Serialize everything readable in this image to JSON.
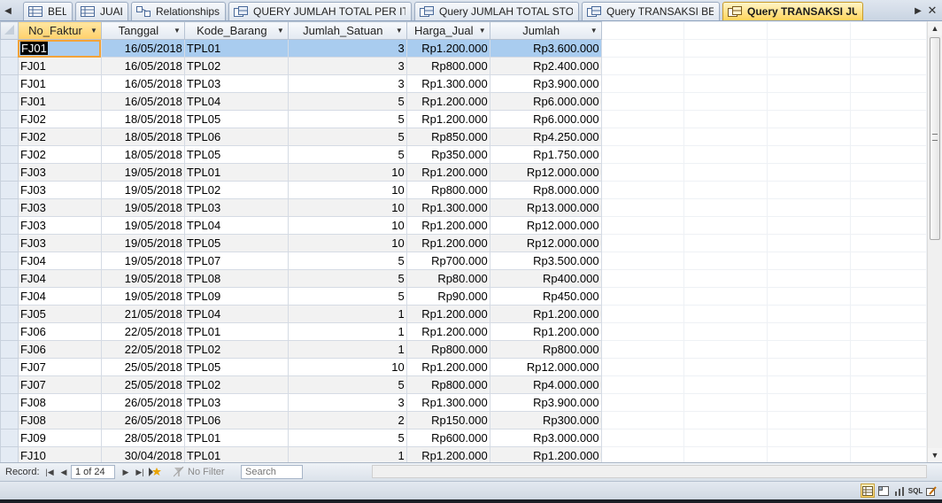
{
  "tabs": [
    {
      "label": "BELI",
      "icon": "table-icon",
      "active": false
    },
    {
      "label": "JUAL",
      "icon": "table-icon",
      "active": false
    },
    {
      "label": "Relationships",
      "icon": "relationships-icon",
      "active": false
    },
    {
      "label": "QUERY JUMLAH TOTAL PER ITEM",
      "icon": "query-icon",
      "active": false
    },
    {
      "label": "Query JUMLAH TOTAL STOCK",
      "icon": "query-icon",
      "active": false
    },
    {
      "label": "Query TRANSAKSI BELI",
      "icon": "query-icon",
      "active": false
    },
    {
      "label": "Query TRANSAKSI JUAL",
      "icon": "query-icon",
      "active": true
    }
  ],
  "columns": [
    "No_Faktur",
    "Tanggal",
    "Kode_Barang",
    "Jumlah_Satuan",
    "Harga_Jual",
    "Jumlah"
  ],
  "rows": [
    [
      "FJ01",
      "16/05/2018",
      "TPL01",
      "3",
      "Rp1.200.000",
      "Rp3.600.000"
    ],
    [
      "FJ01",
      "16/05/2018",
      "TPL02",
      "3",
      "Rp800.000",
      "Rp2.400.000"
    ],
    [
      "FJ01",
      "16/05/2018",
      "TPL03",
      "3",
      "Rp1.300.000",
      "Rp3.900.000"
    ],
    [
      "FJ01",
      "16/05/2018",
      "TPL04",
      "5",
      "Rp1.200.000",
      "Rp6.000.000"
    ],
    [
      "FJ02",
      "18/05/2018",
      "TPL05",
      "5",
      "Rp1.200.000",
      "Rp6.000.000"
    ],
    [
      "FJ02",
      "18/05/2018",
      "TPL06",
      "5",
      "Rp850.000",
      "Rp4.250.000"
    ],
    [
      "FJ02",
      "18/05/2018",
      "TPL05",
      "5",
      "Rp350.000",
      "Rp1.750.000"
    ],
    [
      "FJ03",
      "19/05/2018",
      "TPL01",
      "10",
      "Rp1.200.000",
      "Rp12.000.000"
    ],
    [
      "FJ03",
      "19/05/2018",
      "TPL02",
      "10",
      "Rp800.000",
      "Rp8.000.000"
    ],
    [
      "FJ03",
      "19/05/2018",
      "TPL03",
      "10",
      "Rp1.300.000",
      "Rp13.000.000"
    ],
    [
      "FJ03",
      "19/05/2018",
      "TPL04",
      "10",
      "Rp1.200.000",
      "Rp12.000.000"
    ],
    [
      "FJ03",
      "19/05/2018",
      "TPL05",
      "10",
      "Rp1.200.000",
      "Rp12.000.000"
    ],
    [
      "FJ04",
      "19/05/2018",
      "TPL07",
      "5",
      "Rp700.000",
      "Rp3.500.000"
    ],
    [
      "FJ04",
      "19/05/2018",
      "TPL08",
      "5",
      "Rp80.000",
      "Rp400.000"
    ],
    [
      "FJ04",
      "19/05/2018",
      "TPL09",
      "5",
      "Rp90.000",
      "Rp450.000"
    ],
    [
      "FJ05",
      "21/05/2018",
      "TPL04",
      "1",
      "Rp1.200.000",
      "Rp1.200.000"
    ],
    [
      "FJ06",
      "22/05/2018",
      "TPL01",
      "1",
      "Rp1.200.000",
      "Rp1.200.000"
    ],
    [
      "FJ06",
      "22/05/2018",
      "TPL02",
      "1",
      "Rp800.000",
      "Rp800.000"
    ],
    [
      "FJ07",
      "25/05/2018",
      "TPL05",
      "10",
      "Rp1.200.000",
      "Rp12.000.000"
    ],
    [
      "FJ07",
      "25/05/2018",
      "TPL02",
      "5",
      "Rp800.000",
      "Rp4.000.000"
    ],
    [
      "FJ08",
      "26/05/2018",
      "TPL03",
      "3",
      "Rp1.300.000",
      "Rp3.900.000"
    ],
    [
      "FJ08",
      "26/05/2018",
      "TPL06",
      "2",
      "Rp150.000",
      "Rp300.000"
    ],
    [
      "FJ09",
      "28/05/2018",
      "TPL01",
      "5",
      "Rp600.000",
      "Rp3.000.000"
    ],
    [
      "FJ10",
      "30/04/2018",
      "TPL01",
      "1",
      "Rp1.200.000",
      "Rp1.200.000"
    ]
  ],
  "selected_row": 1,
  "navigation": {
    "record_label": "Record:",
    "record_position": "1 of 24",
    "filter_label": "No Filter",
    "search_placeholder": "Search"
  },
  "status_views": [
    "datasheet-view-icon",
    "pivottable-view-icon",
    "pivotchart-view-icon",
    "sql-view-icon",
    "design-view-icon"
  ],
  "status_sql_label": "SQL",
  "colors": {
    "active_tab": "#ffd45a",
    "selected_row": "#a9ccef",
    "alt_row": "#f2f2f2"
  }
}
